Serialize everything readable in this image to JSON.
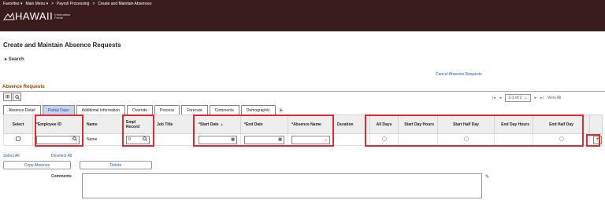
{
  "menu": {
    "favorites": "Favorites ▾",
    "main_menu": "Main Menu ▾",
    "sep1": ">",
    "payroll": "Payroll Processing",
    "sep2": ">",
    "current": "Create and Maintain Absences"
  },
  "logo": {
    "word": "HAWAII",
    "sub1": "Information",
    "sub2": "Portal"
  },
  "page_title": "Create and Maintain Absence Requests",
  "search_label": "Search",
  "cancel_link": "Cancel Absence Requests",
  "section_title": "Absence Requests",
  "pager": {
    "first": "|◂",
    "prev": "◂",
    "range": "1-1 of 1",
    "next": "▸",
    "last": "▸|",
    "view_all": "View All"
  },
  "tabs": [
    "Absence Detail",
    "Partial Days",
    "Additional Information",
    "Override",
    "Process",
    "Forecast",
    "Comments",
    "Demographic"
  ],
  "active_tab_index": 1,
  "columns": {
    "select": "Select",
    "employee_id": "*Employee ID",
    "name": "Name",
    "empl_record": "Empl Record",
    "job_title": "Job Title",
    "start_date": "*Start Date",
    "end_date": "*End Date",
    "absence_name": "*Absence Name",
    "duration": "Duration",
    "all_days": "All Days",
    "start_day_hours": "Start Day Hours",
    "start_half_day": "Start Half Day",
    "end_day_hours": "End Day Hours",
    "end_half_day": "End Half Day"
  },
  "row": {
    "name": "Name",
    "empl_record": "0"
  },
  "select_all": "Select All",
  "deselect_all": "Deselect All",
  "copy_absence": "Copy Absence",
  "delete": "Delete",
  "comments_label": "Comments",
  "accent_color": "#e02a32",
  "header_color": "#3b1c1c"
}
